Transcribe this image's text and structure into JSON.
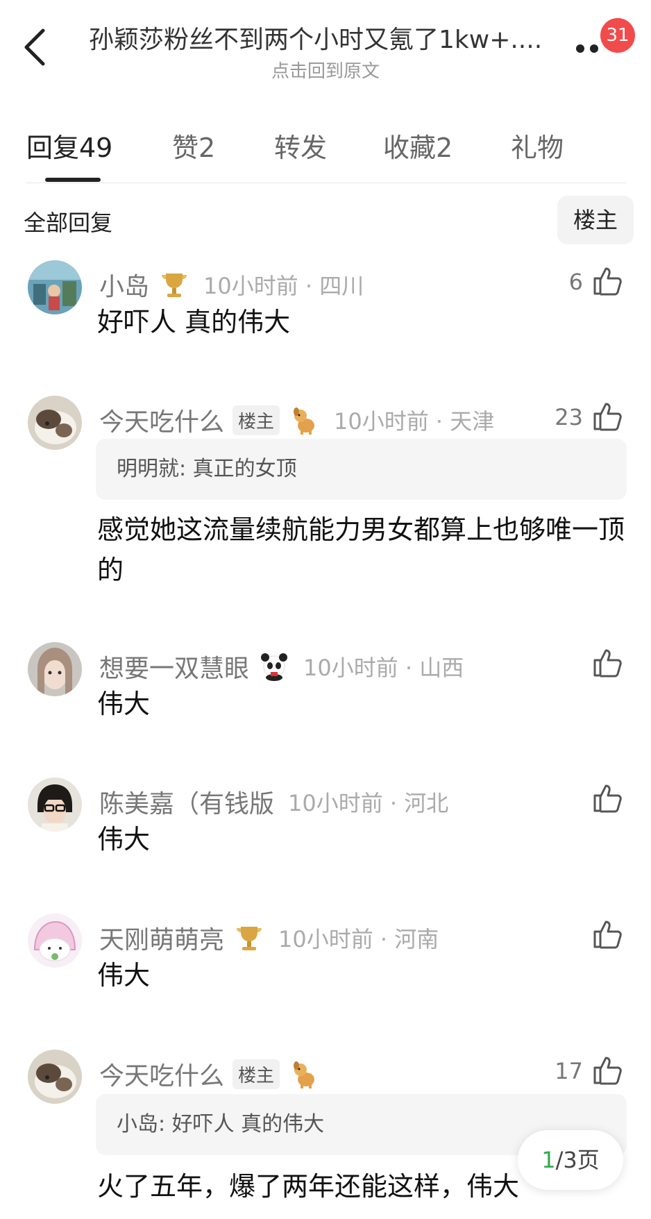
{
  "header": {
    "title": "孙颖莎粉丝不到两个小时又氪了1kw+....",
    "subtitle": "点击回到原文",
    "badge": "31"
  },
  "tabs": [
    {
      "label": "回复49",
      "active": true
    },
    {
      "label": "赞2",
      "active": false
    },
    {
      "label": "转发",
      "active": false
    },
    {
      "label": "收藏2",
      "active": false
    },
    {
      "label": "礼物",
      "active": false
    }
  ],
  "filter": {
    "label": "全部回复",
    "owner_button": "楼主"
  },
  "comments": [
    {
      "user": "小岛",
      "deco_icon": "gold-trophy-icon",
      "time": "10小时前 · 四川",
      "likes": "6",
      "text": "好吓人 真的伟大"
    },
    {
      "user": "今天吃什么",
      "tag": "楼主",
      "deco_icon": "dog-icon",
      "time": "10小时前 · 天津",
      "likes": "23",
      "quote": "明明就: 真正的女顶",
      "text": "感觉她这流量续航能力男女都算上也够唯一顶的"
    },
    {
      "user": "想要一双慧眼",
      "deco_icon": "panda-icon",
      "time": "10小时前 · 山西",
      "likes": "",
      "text": "伟大"
    },
    {
      "user": "陈美嘉（有钱版",
      "time": "10小时前 · 河北",
      "likes": "",
      "text": "伟大"
    },
    {
      "user": "天刚萌萌亮",
      "deco_icon": "gold-trophy-icon",
      "time": "10小时前 · 河南",
      "likes": "",
      "text": "伟大"
    },
    {
      "user": "今天吃什么",
      "tag": "楼主",
      "deco_icon": "dog-icon",
      "time": "",
      "likes": "17",
      "quote": "小岛: 好吓人 真的伟大",
      "text": "火了五年，爆了两年还能这样，伟大"
    }
  ],
  "pager": {
    "current": "1",
    "total": "/3页"
  }
}
